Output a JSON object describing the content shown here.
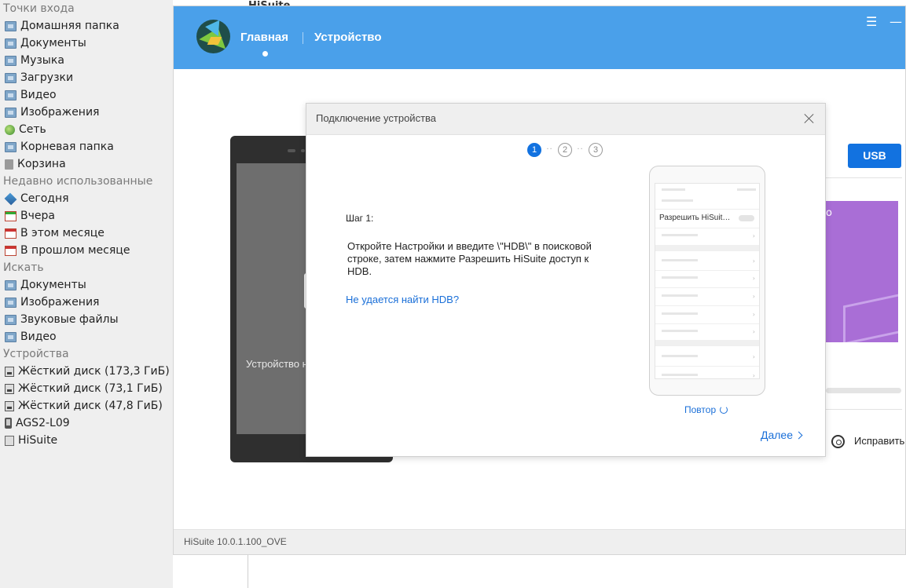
{
  "file_manager": {
    "sections": [
      {
        "title": "Точки входа",
        "items": [
          {
            "label": "Домашняя папка",
            "icon": "home-folder-icon"
          },
          {
            "label": "Документы",
            "icon": "folder-icon"
          },
          {
            "label": "Музыка",
            "icon": "folder-icon"
          },
          {
            "label": "Загрузки",
            "icon": "folder-icon"
          },
          {
            "label": "Видео",
            "icon": "folder-icon"
          },
          {
            "label": "Изображения",
            "icon": "folder-icon"
          },
          {
            "label": "Сеть",
            "icon": "network-icon"
          },
          {
            "label": "Корневая папка",
            "icon": "folder-icon"
          },
          {
            "label": "Корзина",
            "icon": "trash-icon"
          }
        ]
      },
      {
        "title": "Недавно использованные",
        "items": [
          {
            "label": "Сегодня",
            "icon": "today-icon"
          },
          {
            "label": "Вчера",
            "icon": "calendar-icon"
          },
          {
            "label": "В этом месяце",
            "icon": "calendar-icon"
          },
          {
            "label": "В прошлом месяце",
            "icon": "calendar-icon"
          }
        ]
      },
      {
        "title": "Искать",
        "items": [
          {
            "label": "Документы",
            "icon": "folder-icon"
          },
          {
            "label": "Изображения",
            "icon": "folder-icon"
          },
          {
            "label": "Звуковые файлы",
            "icon": "folder-icon"
          },
          {
            "label": "Видео",
            "icon": "folder-icon"
          }
        ]
      },
      {
        "title": "Устройства",
        "items": [
          {
            "label": "Жёсткий диск (173,3 ГиБ)",
            "icon": "hard-disk-icon"
          },
          {
            "label": "Жёсткий диск (73,1 ГиБ)",
            "icon": "hard-disk-icon"
          },
          {
            "label": "Жёсткий диск (47,8 ГиБ)",
            "icon": "hard-disk-icon"
          },
          {
            "label": "AGS2-L09",
            "icon": "phone-icon"
          },
          {
            "label": "HiSuite",
            "icon": "hisuite-drive-icon"
          }
        ]
      }
    ],
    "behind_title": "HiSuite"
  },
  "hisuite": {
    "nav": {
      "home": "Главная",
      "device": "Устройство"
    },
    "version": "HiSuite 10.0.1.100_OVE",
    "background": {
      "phone_status": "Устройство н",
      "usb_button": "USB",
      "promo_char": "о",
      "fix_label": "Исправить"
    },
    "colors": {
      "header": "#4aa0ea",
      "accent": "#1272e0",
      "link": "#1a6fd8",
      "promo": "#a96ed6"
    }
  },
  "dialog": {
    "title": "Подключение устройства",
    "steps": [
      "1",
      "2",
      "3"
    ],
    "active_step": 1,
    "step_heading": "Шаг 1:",
    "step_body": "Откройте Настройки и введите \\\"HDB\\\" в поисковой строке, затем нажмите Разрешить HiSuite доступ к HDB.",
    "help_link": "Не удается найти HDB?",
    "illustration_allow": "Разрешить HiSuit…",
    "retry": "Повтор",
    "next": "Далее"
  }
}
